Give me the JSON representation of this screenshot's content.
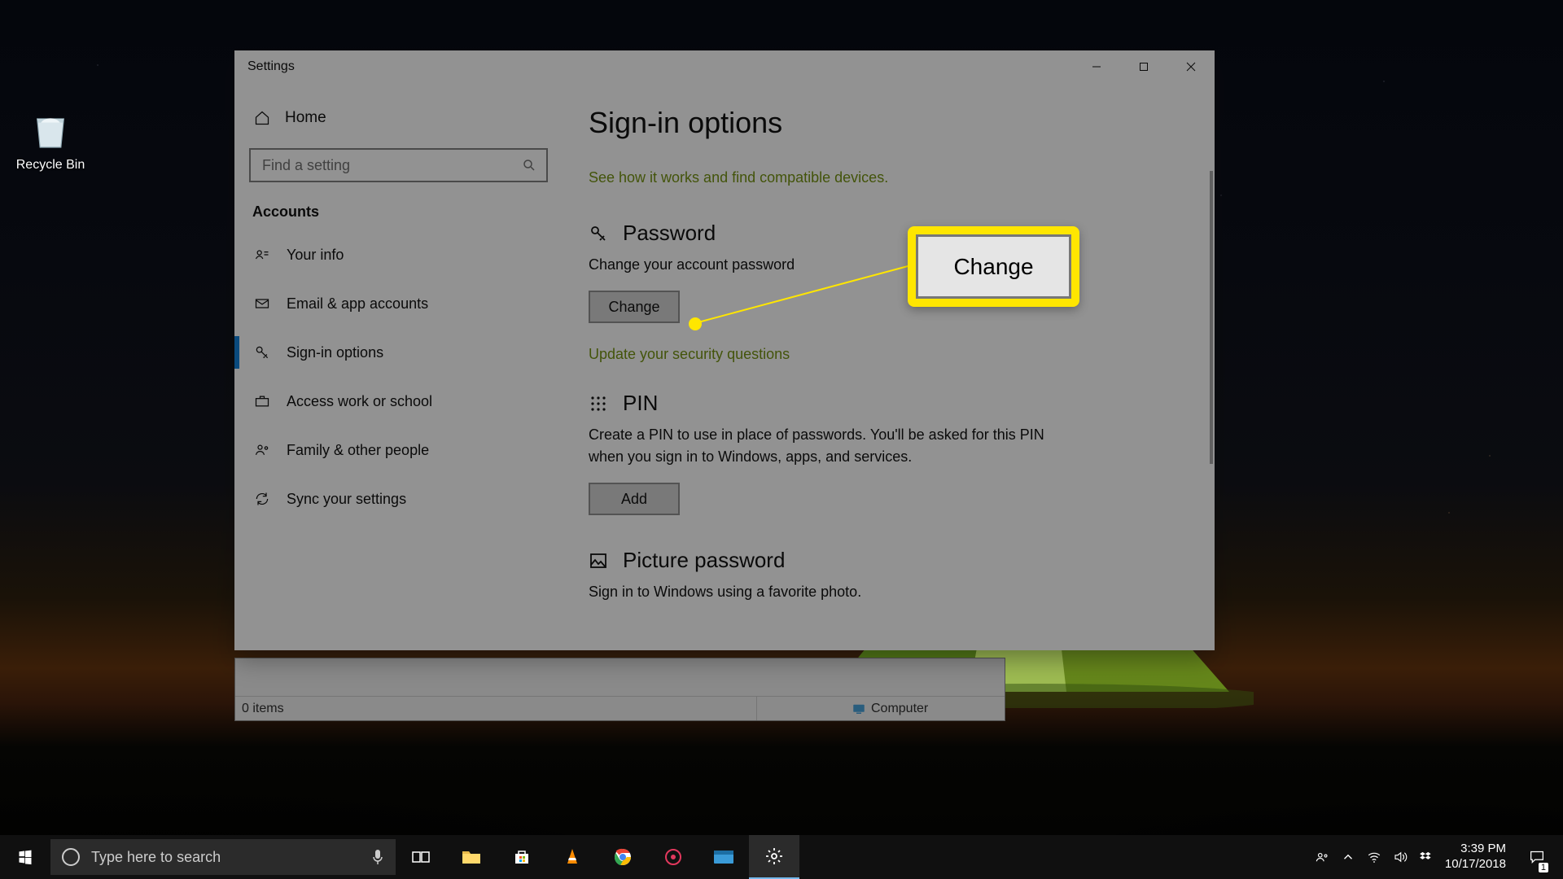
{
  "desktop": {
    "recycle_bin": "Recycle Bin"
  },
  "explorer": {
    "items": "0 items",
    "computer": "Computer"
  },
  "window": {
    "title": "Settings",
    "home": "Home",
    "search_placeholder": "Find a setting",
    "category": "Accounts",
    "nav": [
      {
        "label": "Your info"
      },
      {
        "label": "Email & app accounts"
      },
      {
        "label": "Sign-in options"
      },
      {
        "label": "Access work or school"
      },
      {
        "label": "Family & other people"
      },
      {
        "label": "Sync your settings"
      }
    ]
  },
  "main": {
    "heading": "Sign-in options",
    "compat_link": "See how it works and find compatible devices.",
    "password": {
      "title": "Password",
      "desc": "Change your account password",
      "button": "Change",
      "security_link": "Update your security questions"
    },
    "pin": {
      "title": "PIN",
      "desc": "Create a PIN to use in place of passwords. You'll be asked for this PIN when you sign in to Windows, apps, and services.",
      "button": "Add"
    },
    "picture": {
      "title": "Picture password",
      "desc": "Sign in to Windows using a favorite photo."
    }
  },
  "callout": {
    "label": "Change"
  },
  "taskbar": {
    "search_placeholder": "Type here to search",
    "time": "3:39 PM",
    "date": "10/17/2018",
    "notif_count": "1"
  }
}
